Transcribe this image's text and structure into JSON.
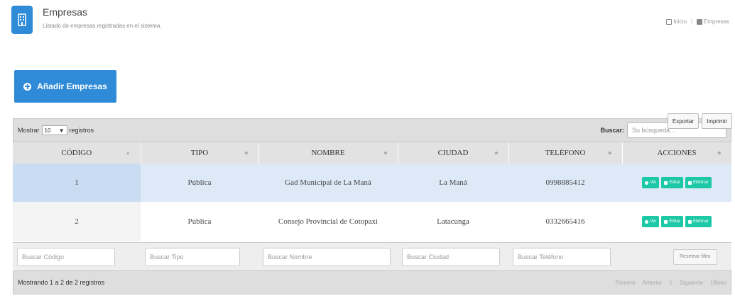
{
  "header": {
    "title": "Empresas",
    "subtitle": "Listado de empresas registradas en el sistema.",
    "breadcrumb": [
      "Inicio",
      "Empresas"
    ]
  },
  "add_button": {
    "label": "Añadir Empresas"
  },
  "tools": {
    "export": "Exportar",
    "print": "Imprimir"
  },
  "table_toolbar": {
    "show_prefix": "Mostrar",
    "page_length": "10",
    "show_suffix": "registros",
    "search_label": "Buscar:",
    "search_placeholder": "Su búsqueda..."
  },
  "columns": [
    "CÓDIGO",
    "TIPO",
    "NOMBRE",
    "CIUDAD",
    "TELÉFONO",
    "ACCIONES"
  ],
  "rows": [
    {
      "codigo": "1",
      "tipo": "Pública",
      "nombre": "Gad Municipal de La Maná",
      "ciudad": "La Maná",
      "telefono": "0998885412"
    },
    {
      "codigo": "2",
      "tipo": "Pública",
      "nombre": "Consejo Provincial de Cotopaxi",
      "ciudad": "Latacunga",
      "telefono": "0332665416"
    }
  ],
  "row_actions": {
    "view": "Ver",
    "edit": "Editar",
    "delete": "Eliminar"
  },
  "footer_filters": {
    "codigo": "Buscar Código",
    "tipo": "Buscar Tipo",
    "nombre": "Buscar Nombre",
    "ciudad": "Buscar Ciudad",
    "telefono": "Buscar Teléfono",
    "reset": "Resetear filtro"
  },
  "info": {
    "text": "Mostrando 1 a 2 de 2 registros",
    "pagination": [
      "Primero",
      "Anterior",
      "1",
      "Siguiente",
      "Último"
    ]
  },
  "colors": {
    "primary": "#2f8bd8",
    "action": "#1cc8a6",
    "selected_row": "#dde9f7"
  }
}
